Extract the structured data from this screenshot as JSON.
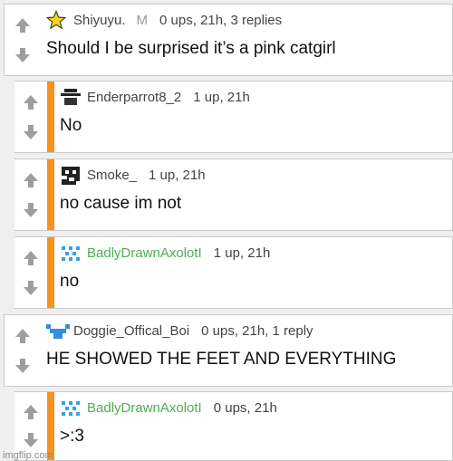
{
  "watermark": "imgflip.com",
  "colors": {
    "accent_bar": "#f7931e",
    "arrow": "#9e9e9e",
    "username_green": "#4caf50"
  },
  "comments": [
    {
      "user": "Shiyuyu.",
      "badge": "M",
      "stats": "0 ups, 21h, 3 replies",
      "text": "Should I be surprised it’s a pink catgirl",
      "avatar": "star-icon"
    },
    {
      "user": "Enderparrot8_2",
      "stats": "1 up, 21h",
      "text": "No",
      "avatar": "pixel-hat-avatar"
    },
    {
      "user": "Smoke_",
      "stats": "1 up, 21h",
      "text": "no cause im not",
      "avatar": "pixel-face-avatar"
    },
    {
      "user": "BadlyDrawnAxolotI",
      "stats": "1 up, 21h",
      "text": "no",
      "avatar": "axolotl-pixel-avatar"
    },
    {
      "user": "Doggie_Offical_Boi",
      "stats": "0 ups, 21h, 1 reply",
      "text": "HE SHOWED THE FEET AND EVERYTHING",
      "avatar": "blue-pixel-avatar"
    },
    {
      "user": "BadlyDrawnAxolotI",
      "stats": "0 ups, 21h",
      "text": ">:3",
      "avatar": "axolotl-pixel-avatar"
    }
  ]
}
